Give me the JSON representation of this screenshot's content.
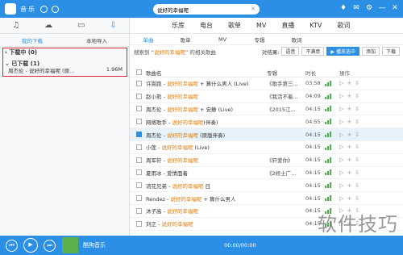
{
  "topbar": {
    "title_blurred": "音乐",
    "search_value": "说好的幸福呢"
  },
  "sidebar": {
    "tabs": [
      "我的下载",
      "本地导入"
    ],
    "downloading": "下载中 (0)",
    "downloaded": "已下载 (1)",
    "download_item": {
      "name": "周杰伦 - 说好的幸福呢 (原...",
      "size": "1.96M"
    }
  },
  "nav": {
    "items": [
      "乐库",
      "电台",
      "歌单",
      "MV",
      "直播",
      "KTV",
      "歌词"
    ]
  },
  "subnav": {
    "items": [
      "单曲",
      "歌单",
      "MV",
      "专辑",
      "歌词"
    ]
  },
  "actionbar": {
    "search_prefix": "搜索到 “",
    "search_keyword": "说好的幸福呢",
    "search_suffix": "” 的相关歌曲",
    "compare_label": "对结果:",
    "compare_options": [
      "语音",
      "不满意"
    ],
    "play_selected": "播放选中",
    "add": "添加",
    "download": "下载"
  },
  "table_header": {
    "song": "歌曲名",
    "album": "专辑",
    "duration": "时长",
    "ops": "操作"
  },
  "rows": [
    {
      "prefix": "许嵩跑 - ",
      "title": "说好的幸福呢",
      "suffix": " + 算什么男人 (Live)",
      "album": "《歌手第三...",
      "duration": "03:58",
      "highlight": false
    },
    {
      "prefix": "赵小熊 - ",
      "title": "说好的幸福呢",
      "suffix": "",
      "album": "《我活不着...",
      "duration": "04:09",
      "highlight": false
    },
    {
      "prefix": "周杰伦 - ",
      "title": "说好的幸福呢",
      "suffix": " + 安静 (Live)",
      "album": "《2015江...",
      "duration": "04:15",
      "highlight": false
    },
    {
      "prefix": "网络歌手 - ",
      "title": "说好的幸福呢",
      "suffix": "(伴奏)",
      "album": "",
      "duration": "04:55",
      "highlight": false
    },
    {
      "prefix": "周杰伦 - ",
      "title": "说好的幸福呢",
      "suffix": " (原版伴奏)",
      "album": "",
      "duration": "04:15",
      "highlight": true
    },
    {
      "prefix": "小莲 - ",
      "title": "说好的幸福呢",
      "suffix": " (Live)",
      "album": "",
      "duration": "04:15",
      "highlight": false
    },
    {
      "prefix": "周军轩 - ",
      "title": "说好的幸福呢",
      "suffix": "",
      "album": "《轩爱你》",
      "duration": "04:15",
      "highlight": false
    },
    {
      "prefix": "夏雨冰 - 爱情面着",
      "title": "",
      "suffix": "",
      "album": "《2修士广...",
      "duration": "04:15",
      "highlight": false
    },
    {
      "prefix": "流花兄弟 - ",
      "title": "说好的幸福呢",
      "suffix": " 日",
      "album": "",
      "duration": "04:15",
      "highlight": false
    },
    {
      "prefix": "Rendez - ",
      "title": "说好的幸福呢",
      "suffix": " + 算什么男人",
      "album": "",
      "duration": "04:15",
      "highlight": false
    },
    {
      "prefix": "沐子高 - ",
      "title": "说好的幸福呢",
      "suffix": "",
      "album": "",
      "duration": "04:15",
      "highlight": false
    },
    {
      "prefix": "刘正 - ",
      "title": "说好的幸福呢",
      "suffix": "",
      "album": "",
      "duration": "04:15",
      "highlight": false
    }
  ],
  "player": {
    "title": "酷狗音乐",
    "time": "00:00/00:00"
  },
  "watermark": "软件技巧",
  "colors": {
    "accent": "#2b8fe6",
    "highlight_box": "#d9232e",
    "keyword": "#e07d10",
    "quality": "#48b548"
  }
}
